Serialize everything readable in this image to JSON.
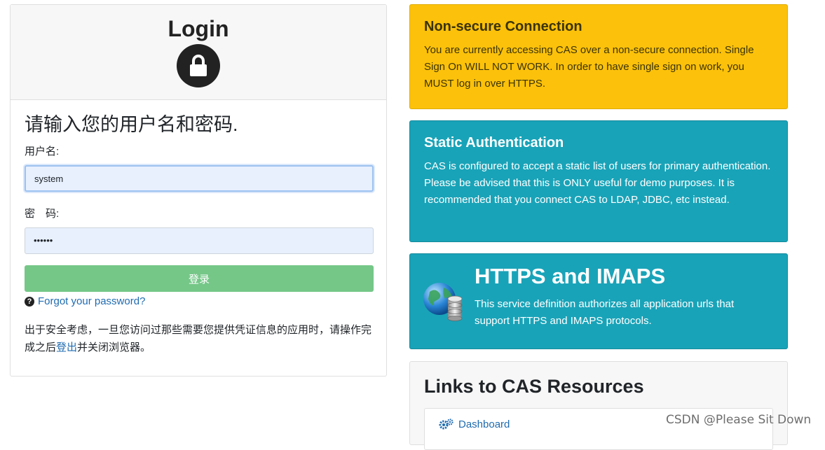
{
  "login": {
    "title": "Login",
    "prompt": "请输入您的用户名和密码.",
    "username_label": "用户名:",
    "username_value": "system",
    "password_label": "密　码:",
    "password_value": "••••••",
    "submit_label": "登录",
    "forgot_label": "Forgot your password?",
    "notice_before": "出于安全考虑，一旦您访问过那些需要您提供凭证信息的应用时，请操作完成之后",
    "notice_link": "登出",
    "notice_after": "并关闭浏览器。"
  },
  "non_secure": {
    "title": "Non-secure Connection",
    "text": "You are currently accessing CAS over a non-secure connection. Single Sign On WILL NOT WORK. In order to have single sign on work, you MUST log in over HTTPS."
  },
  "static_auth": {
    "title": "Static Authentication",
    "text": "CAS is configured to accept a static list of users for primary authentication. Please be advised that this is ONLY useful for demo purposes. It is recommended that you connect CAS to LDAP, JDBC, etc instead."
  },
  "https": {
    "title": "HTTPS and IMAPS",
    "text": "This service definition authorizes all application urls that support HTTPS and IMAPS protocols."
  },
  "links": {
    "title": "Links to CAS Resources",
    "items": [
      {
        "label": "Dashboard"
      }
    ]
  },
  "watermark": "CSDN @Please Sit Down",
  "colors": {
    "warning": "#fcc10a",
    "info": "#19a3b8",
    "button": "#75c788",
    "link": "#1f6bb0"
  },
  "icons": [
    "lock-icon",
    "question-circle-icon",
    "globe-database-icon",
    "cogs-icon"
  ]
}
